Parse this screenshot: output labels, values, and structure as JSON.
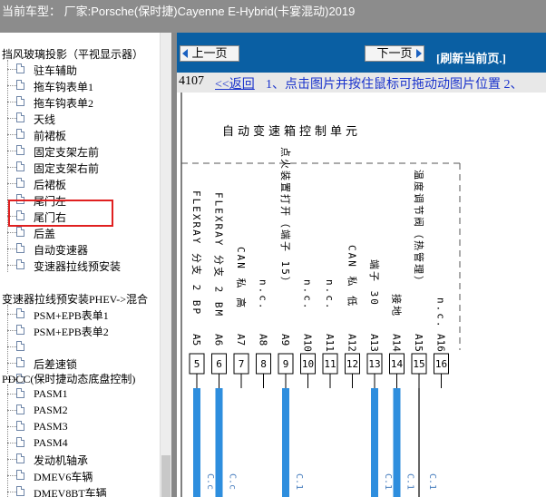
{
  "window": {
    "title": "当前车型：  厂家:Porsche(保时捷)Cayenne E-Hybrid(卡宴混动)2019"
  },
  "tree": {
    "header1": "挡风玻璃投影（平视显示器）",
    "items_a": [
      "驻车辅助",
      "拖车钩表单1",
      "拖车钩表单2",
      "天线",
      "前裙板",
      "固定支架左前",
      "固定支架右前",
      "后裙板",
      "尾门左",
      "尾门右",
      "后盖",
      "自动变速器",
      "变速器拉线预安装"
    ],
    "header2": "变速器拉线预安装PHEV->混合",
    "items_b": [
      "PSM+EPB表单1",
      "PSM+EPB表单2",
      "",
      "后差速锁",
      ""
    ],
    "header3": "PDCC(保时捷动态底盘控制)",
    "items_c": [
      "PASM1",
      "PASM2",
      "PASM3",
      "PASM4",
      "发动机轴承",
      "DMEV6车辆",
      "DMEV8BT车辆"
    ]
  },
  "nav": {
    "prev_label": "上一页",
    "next_label": "下一页",
    "refresh_label": "[刷新当前页.]"
  },
  "info": {
    "page_no": "4107",
    "back_label": "<<返回",
    "hint": "1、点击图片并按住鼠标可拖动动图片位置 2、"
  },
  "diagram": {
    "title": "自动变速箱控制单元",
    "pins": [
      {
        "label": "FLEXRAY 分支 2 BP",
        "pin": "A5",
        "num": "5",
        "wire": "blue"
      },
      {
        "label": "FLEXRAY 分支 2 BM",
        "pin": "A6",
        "num": "6",
        "wire": "blue"
      },
      {
        "label": "CAN 私 高",
        "pin": "A7",
        "num": "7",
        "wire": "none"
      },
      {
        "label": "n.c.",
        "pin": "A8",
        "num": "8",
        "wire": "none"
      },
      {
        "label": "点火装置打开（端子 15）",
        "pin": "A9",
        "num": "9",
        "wire": "blue"
      },
      {
        "label": "n.c.",
        "pin": "A10",
        "num": "10",
        "wire": "none"
      },
      {
        "label": "n.c.",
        "pin": "A11",
        "num": "11",
        "wire": "none"
      },
      {
        "label": "CAN 私 低",
        "pin": "A12",
        "num": "12",
        "wire": "none"
      },
      {
        "label": "端子 30",
        "pin": "A13",
        "num": "13",
        "wire": "blue"
      },
      {
        "label": "接地",
        "pin": "A14",
        "num": "14",
        "wire": "blue"
      },
      {
        "label": "温度调节阀（热管理）",
        "pin": "A15",
        "num": "15",
        "wire": "black"
      },
      {
        "label": "n.c.",
        "pin": "A16",
        "num": "16",
        "wire": "none"
      }
    ],
    "wire_tags": [
      "C.c",
      "C.c",
      "C.1",
      "C.1",
      "C.1",
      "C.1"
    ]
  },
  "colors": {
    "nav_bg": "#0a5fa3",
    "wire_blue": "#2e8ede",
    "highlight": "#e02020"
  }
}
